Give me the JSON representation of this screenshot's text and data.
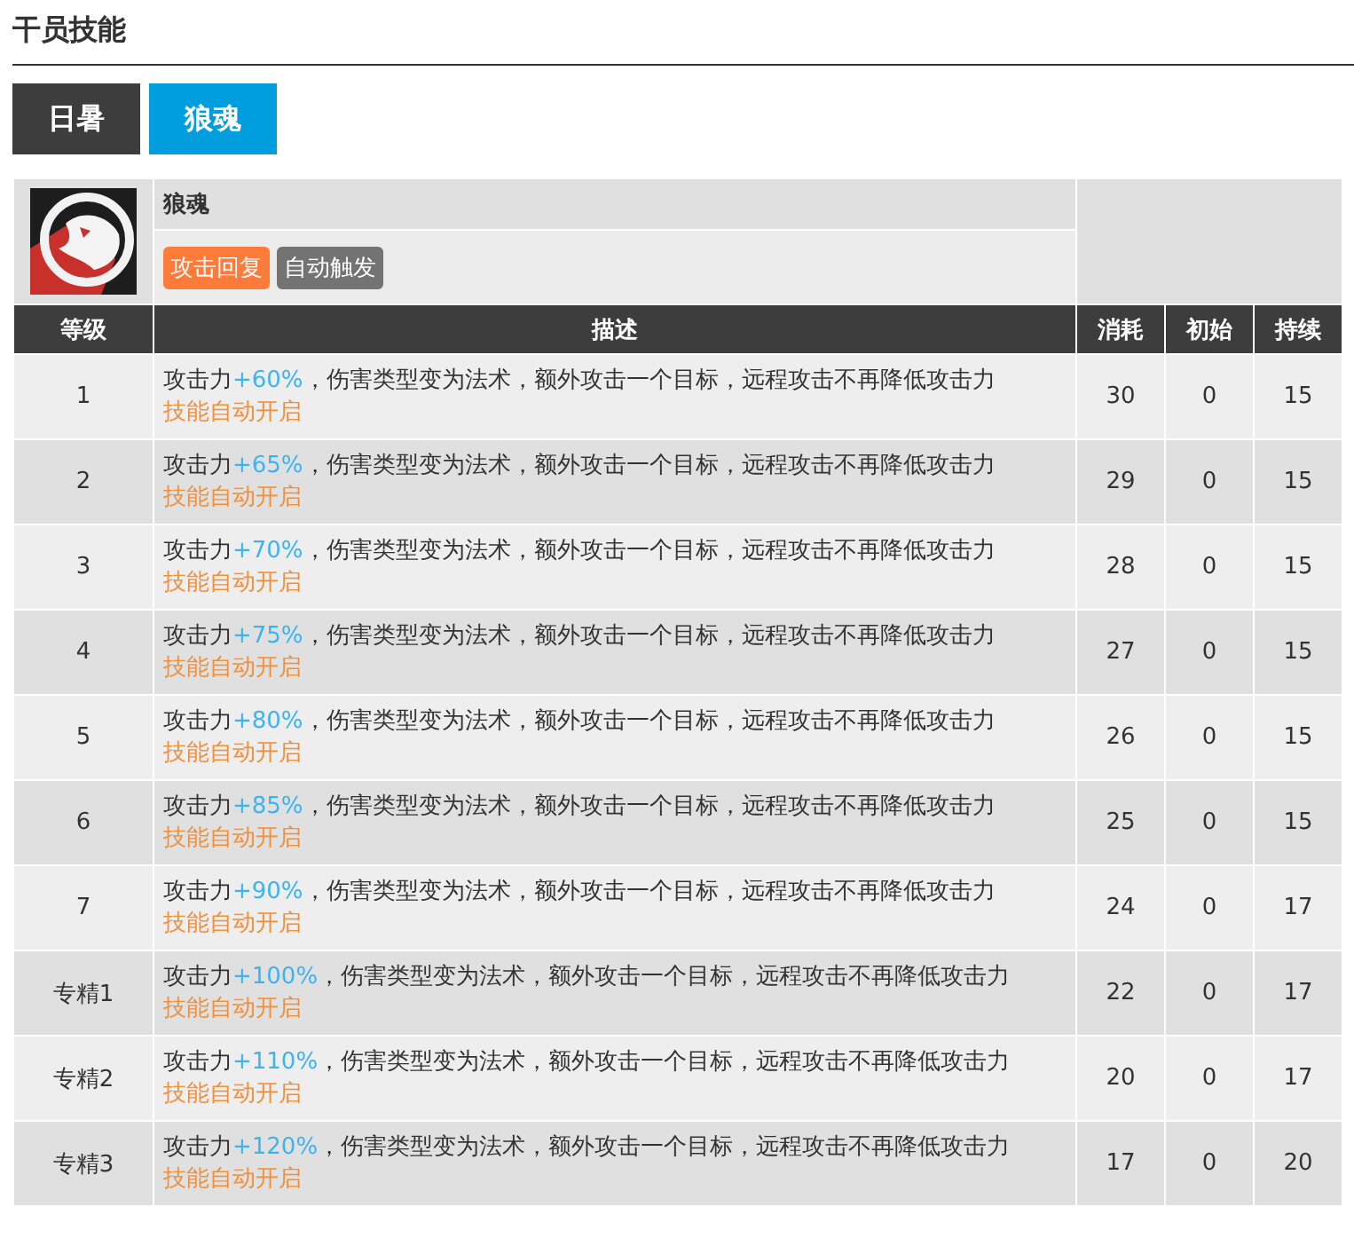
{
  "title": "干员技能",
  "tabs": [
    {
      "label": "日暑",
      "selected": false
    },
    {
      "label": "狼魂",
      "selected": true
    }
  ],
  "skill": {
    "name": "狼魂",
    "tags": [
      {
        "label": "攻击回复",
        "color": "#ff7b3a"
      },
      {
        "label": "自动触发",
        "color": "#737373"
      }
    ]
  },
  "columns": [
    "等级",
    "描述",
    "消耗",
    "初始",
    "持续"
  ],
  "rows": [
    {
      "level": "1",
      "prefix": "攻击力",
      "bonus": "+60%",
      "suffix": "，伤害类型变为法术，额外攻击一个目标，远程攻击不再降低攻击力",
      "note": "技能自动开启",
      "cost": "30",
      "initial": "0",
      "duration": "15"
    },
    {
      "level": "2",
      "prefix": "攻击力",
      "bonus": "+65%",
      "suffix": "，伤害类型变为法术，额外攻击一个目标，远程攻击不再降低攻击力",
      "note": "技能自动开启",
      "cost": "29",
      "initial": "0",
      "duration": "15"
    },
    {
      "level": "3",
      "prefix": "攻击力",
      "bonus": "+70%",
      "suffix": "，伤害类型变为法术，额外攻击一个目标，远程攻击不再降低攻击力",
      "note": "技能自动开启",
      "cost": "28",
      "initial": "0",
      "duration": "15"
    },
    {
      "level": "4",
      "prefix": "攻击力",
      "bonus": "+75%",
      "suffix": "，伤害类型变为法术，额外攻击一个目标，远程攻击不再降低攻击力",
      "note": "技能自动开启",
      "cost": "27",
      "initial": "0",
      "duration": "15"
    },
    {
      "level": "5",
      "prefix": "攻击力",
      "bonus": "+80%",
      "suffix": "，伤害类型变为法术，额外攻击一个目标，远程攻击不再降低攻击力",
      "note": "技能自动开启",
      "cost": "26",
      "initial": "0",
      "duration": "15"
    },
    {
      "level": "6",
      "prefix": "攻击力",
      "bonus": "+85%",
      "suffix": "，伤害类型变为法术，额外攻击一个目标，远程攻击不再降低攻击力",
      "note": "技能自动开启",
      "cost": "25",
      "initial": "0",
      "duration": "15"
    },
    {
      "level": "7",
      "prefix": "攻击力",
      "bonus": "+90%",
      "suffix": "，伤害类型变为法术，额外攻击一个目标，远程攻击不再降低攻击力",
      "note": "技能自动开启",
      "cost": "24",
      "initial": "0",
      "duration": "17"
    },
    {
      "level": "专精1",
      "prefix": "攻击力",
      "bonus": "+100%",
      "suffix": "，伤害类型变为法术，额外攻击一个目标，远程攻击不再降低攻击力",
      "note": "技能自动开启",
      "cost": "22",
      "initial": "0",
      "duration": "17"
    },
    {
      "level": "专精2",
      "prefix": "攻击力",
      "bonus": "+110%",
      "suffix": "，伤害类型变为法术，额外攻击一个目标，远程攻击不再降低攻击力",
      "note": "技能自动开启",
      "cost": "20",
      "initial": "0",
      "duration": "17"
    },
    {
      "level": "专精3",
      "prefix": "攻击力",
      "bonus": "+120%",
      "suffix": "，伤害类型变为法术，额外攻击一个目标，远程攻击不再降低攻击力",
      "note": "技能自动开启",
      "cost": "17",
      "initial": "0",
      "duration": "20"
    }
  ]
}
